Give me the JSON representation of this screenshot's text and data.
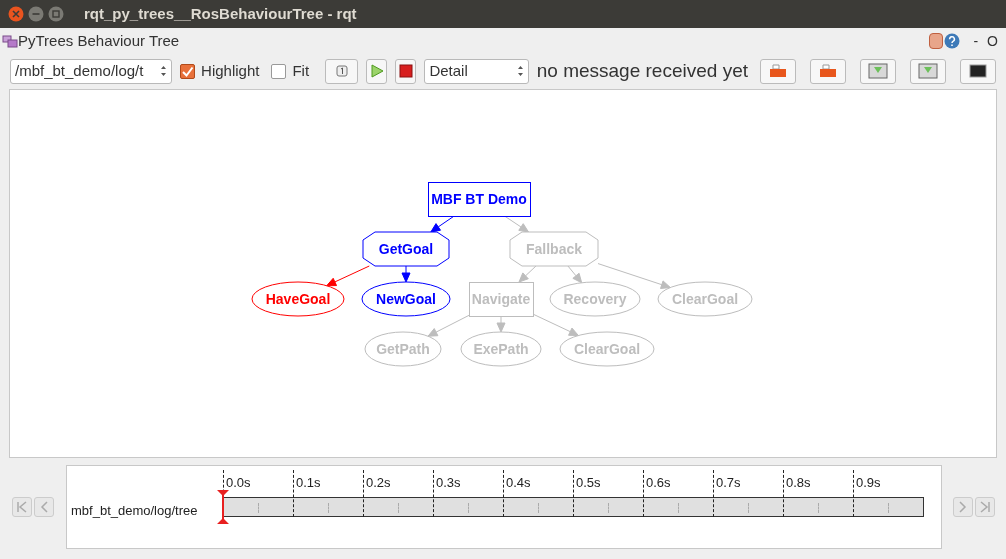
{
  "window": {
    "title": "rqt_py_trees__RosBehaviourTree - rqt"
  },
  "plugin": {
    "title": "PyTrees Behaviour Tree",
    "dock_controls": [
      "-",
      "O"
    ]
  },
  "toolbar": {
    "topic": "/mbf_bt_demo/log/t",
    "highlight": {
      "label": "Highlight",
      "checked": true
    },
    "fit": {
      "label": "Fit",
      "checked": false
    },
    "detail": "Detail",
    "message": "no message received yet"
  },
  "tree": {
    "label": "MBF BT Demo",
    "kind": "box",
    "color": "#0000ff",
    "children": [
      {
        "label": "GetGoal",
        "kind": "octagon",
        "color": "#0000ff",
        "children": [
          {
            "label": "HaveGoal",
            "kind": "ellipse",
            "color": "#ff0000"
          },
          {
            "label": "NewGoal",
            "kind": "ellipse",
            "color": "#0000ff"
          }
        ]
      },
      {
        "label": "Fallback",
        "kind": "octagon",
        "color": "#bdbdbd",
        "children": [
          {
            "label": "Navigate",
            "kind": "box",
            "color": "#bdbdbd",
            "children": [
              {
                "label": "GetPath",
                "kind": "ellipse",
                "color": "#bdbdbd"
              },
              {
                "label": "ExePath",
                "kind": "ellipse",
                "color": "#bdbdbd"
              },
              {
                "label": "ClearGoal",
                "kind": "ellipse",
                "color": "#bdbdbd"
              }
            ]
          },
          {
            "label": "Recovery",
            "kind": "ellipse",
            "color": "#bdbdbd"
          },
          {
            "label": "ClearGoal",
            "kind": "ellipse",
            "color": "#bdbdbd"
          }
        ]
      }
    ]
  },
  "timeline": {
    "topic": "mbf_bt_demo/log/tree",
    "ticks": [
      "0.0s",
      "0.1s",
      "0.2s",
      "0.3s",
      "0.4s",
      "0.5s",
      "0.6s",
      "0.7s",
      "0.8s",
      "0.9s"
    ]
  }
}
